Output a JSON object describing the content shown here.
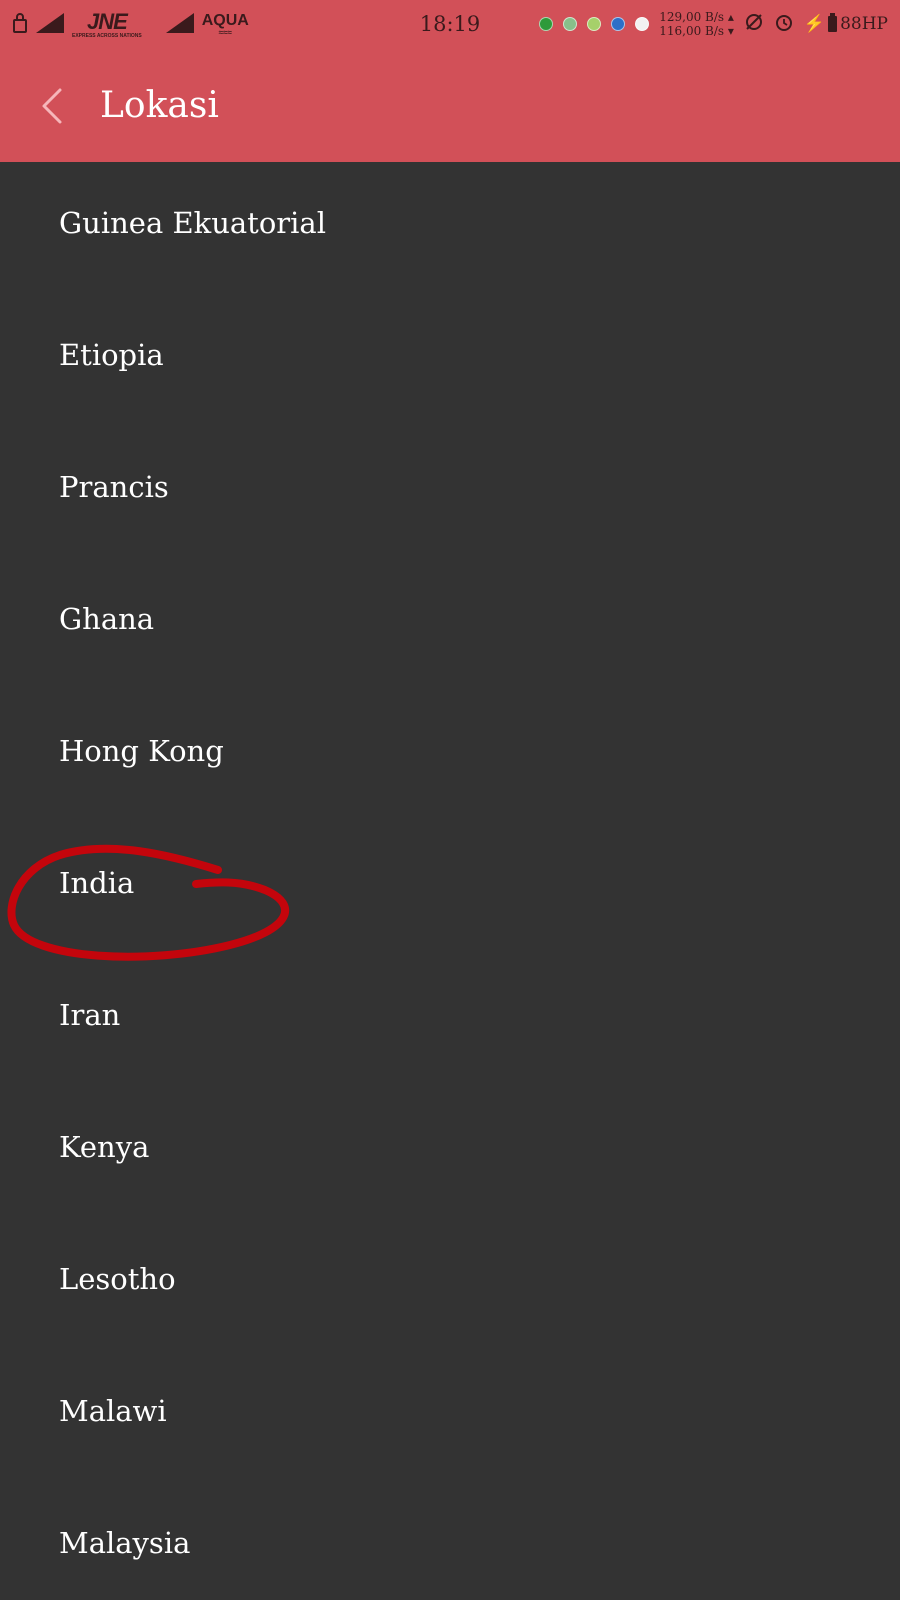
{
  "statusbar": {
    "carrier1": {
      "logo": "JNE",
      "tagline": "EXPRESS ACROSS NATIONS"
    },
    "carrier2": {
      "logo": "AQUA",
      "waves": "≈≈≈"
    },
    "time": "18:19",
    "net_up": "129,00 B/s ▴",
    "net_down": "116,00 B/s ▾",
    "battery": "88HP",
    "notif_colors": [
      "#2e9a3a",
      "#88c08a",
      "#a6d06a",
      "#2d6fc8",
      "#f2f2f2"
    ]
  },
  "toolbar": {
    "title": "Lokasi",
    "back_icon": "chevron-left-icon"
  },
  "colors": {
    "header": "#d25058",
    "background": "#333333",
    "annotation": "#c4050c"
  },
  "locations": [
    "Guinea Ekuatorial",
    "Etiopia",
    "Prancis",
    "Ghana",
    "Hong Kong",
    "India",
    "Iran",
    "Kenya",
    "Lesotho",
    "Malawi",
    "Malaysia"
  ]
}
